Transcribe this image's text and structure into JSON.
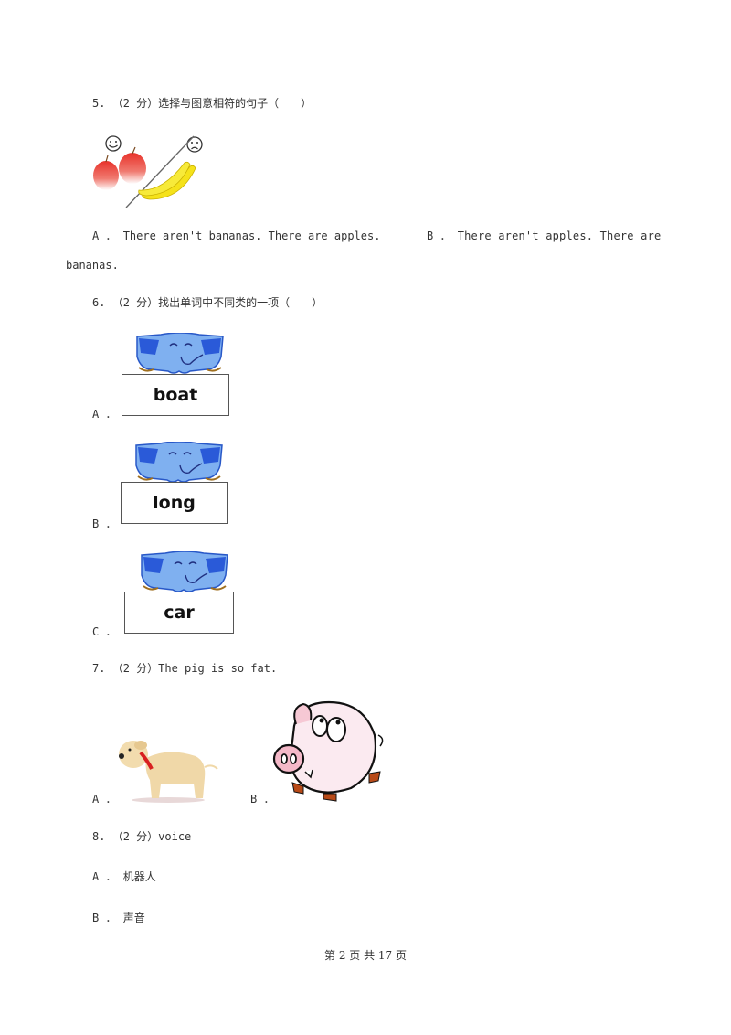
{
  "questions": [
    {
      "number": "5.",
      "score": "（2 分）",
      "prompt": "选择与图意相符的句子（　　）",
      "image": "apples-happy-bananas-sad",
      "options": [
        {
          "label": "A ．",
          "text": "There aren't bananas. There are apples."
        },
        {
          "label": "B ．",
          "text": "There aren't apples. There are",
          "continuation": "bananas."
        }
      ]
    },
    {
      "number": "6.",
      "score": "（2 分）",
      "prompt": "找出单词中不同类的一项（　　）",
      "options": [
        {
          "label": "A ．",
          "word": "boat",
          "image": "elephant-holding-sign"
        },
        {
          "label": "B ．",
          "word": "long",
          "image": "elephant-holding-sign"
        },
        {
          "label": "C ．",
          "word": "car",
          "image": "elephant-holding-sign"
        }
      ]
    },
    {
      "number": "7.",
      "score": "（2 分）",
      "prompt": "The pig is so fat.",
      "options": [
        {
          "label": "A ．",
          "image": "dog"
        },
        {
          "label": "B ．",
          "image": "fat-pig"
        }
      ]
    },
    {
      "number": "8.",
      "score": "（2 分）",
      "prompt": "voice",
      "options": [
        {
          "label": "A ．",
          "text": "机器人"
        },
        {
          "label": "B ．",
          "text": "声音"
        }
      ]
    }
  ],
  "footer": "第 2 页 共 17 页"
}
